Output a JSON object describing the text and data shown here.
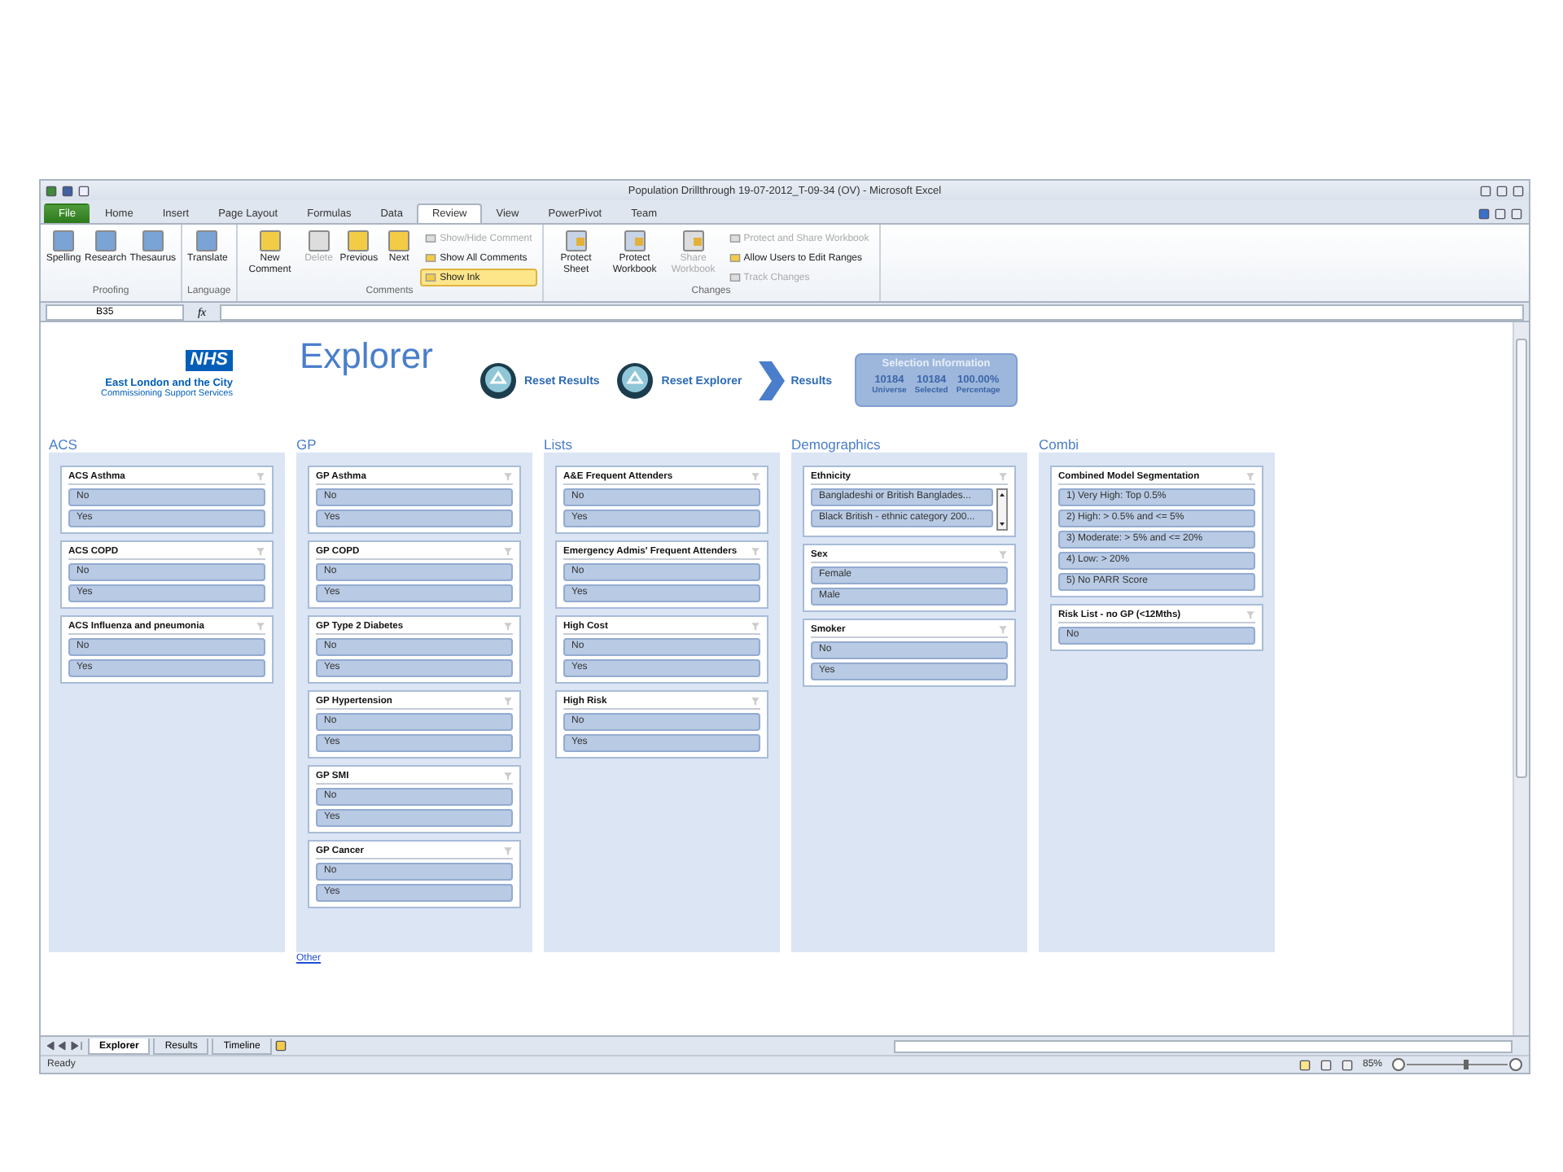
{
  "window": {
    "title": "Population Drillthrough 19-07-2012_T-09-34 (OV)  -  Microsoft Excel"
  },
  "ribbon_tabs": [
    {
      "label": "File",
      "kind": "file",
      "selected": false
    },
    {
      "label": "Home",
      "kind": "tab",
      "selected": false
    },
    {
      "label": "Insert",
      "kind": "tab",
      "selected": false
    },
    {
      "label": "Page Layout",
      "kind": "tab",
      "selected": false
    },
    {
      "label": "Formulas",
      "kind": "tab",
      "selected": false
    },
    {
      "label": "Data",
      "kind": "tab",
      "selected": false
    },
    {
      "label": "Review",
      "kind": "tab",
      "selected": true
    },
    {
      "label": "View",
      "kind": "tab",
      "selected": false
    },
    {
      "label": "PowerPivot",
      "kind": "tab",
      "selected": false
    },
    {
      "label": "Team",
      "kind": "tab",
      "selected": false
    }
  ],
  "ribbon_groups": [
    {
      "label": "Proofing",
      "buttons": [
        {
          "label": "Spelling",
          "disabled": false
        },
        {
          "label": "Research",
          "disabled": false
        },
        {
          "label": "Thesaurus",
          "disabled": false
        }
      ]
    },
    {
      "label": "Language",
      "buttons": [
        {
          "label": "Translate",
          "disabled": false
        }
      ]
    },
    {
      "label": "Comments",
      "buttons": [
        {
          "label": "New Comment",
          "disabled": false
        },
        {
          "label": "Delete",
          "disabled": true
        },
        {
          "label": "Previous",
          "disabled": false
        },
        {
          "label": "Next",
          "disabled": false
        }
      ],
      "small_buttons": [
        {
          "label": "Show/Hide Comment",
          "disabled": true,
          "on": false
        },
        {
          "label": "Show All Comments",
          "disabled": false,
          "on": false
        },
        {
          "label": "Show Ink",
          "disabled": false,
          "on": true
        }
      ]
    },
    {
      "label": "Changes",
      "buttons": [
        {
          "label": "Protect Sheet",
          "disabled": false
        },
        {
          "label": "Protect Workbook",
          "disabled": false
        },
        {
          "label": "Share Workbook",
          "disabled": true
        }
      ],
      "small_buttons": [
        {
          "label": "Protect and Share Workbook",
          "disabled": true,
          "on": false
        },
        {
          "label": "Allow Users to Edit Ranges",
          "disabled": false,
          "on": false
        },
        {
          "label": "Track Changes",
          "disabled": true,
          "on": false
        }
      ]
    }
  ],
  "formula_bar": {
    "name_box": "B35",
    "function_label": "fx"
  },
  "sheet": {
    "logo": {
      "mark": "NHS",
      "name": "East London and the City",
      "subtitle": "Commissioning Support Services"
    },
    "title": "Explorer",
    "actions": [
      {
        "label": "Reset Results",
        "kind": "reset"
      },
      {
        "label": "Reset Explorer",
        "kind": "reset"
      },
      {
        "label": "Results",
        "kind": "next"
      }
    ],
    "selection_info": {
      "title": "Selection Information",
      "stats": [
        {
          "value": "10184",
          "label": "Universe"
        },
        {
          "value": "10184",
          "label": "Selected"
        },
        {
          "value": "100.00%",
          "label": "Percentage"
        }
      ]
    },
    "columns": [
      {
        "heading": "ACS",
        "cards": [
          {
            "title": "ACS Asthma",
            "items": [
              "No",
              "Yes"
            ]
          },
          {
            "title": "ACS COPD",
            "items": [
              "No",
              "Yes"
            ]
          },
          {
            "title": "ACS Influenza and pneumonia",
            "items": [
              "No",
              "Yes"
            ]
          }
        ]
      },
      {
        "heading": "GP",
        "cards": [
          {
            "title": "GP Asthma",
            "items": [
              "No",
              "Yes"
            ]
          },
          {
            "title": "GP COPD",
            "items": [
              "No",
              "Yes"
            ]
          },
          {
            "title": "GP Type 2 Diabetes",
            "items": [
              "No",
              "Yes"
            ]
          },
          {
            "title": "GP Hypertension",
            "items": [
              "No",
              "Yes"
            ]
          },
          {
            "title": "GP SMI",
            "items": [
              "No",
              "Yes"
            ]
          },
          {
            "title": "GP Cancer",
            "items": [
              "No",
              "Yes"
            ]
          }
        ],
        "link": "Other"
      },
      {
        "heading": "Lists",
        "cards": [
          {
            "title": "A&E Frequent Attenders",
            "items": [
              "No",
              "Yes"
            ]
          },
          {
            "title": "Emergency Admis' Frequent Attenders",
            "items": [
              "No",
              "Yes"
            ]
          },
          {
            "title": "High Cost",
            "items": [
              "No",
              "Yes"
            ]
          },
          {
            "title": "High Risk",
            "items": [
              "No",
              "Yes"
            ]
          }
        ]
      },
      {
        "heading": "Demographics",
        "cards": [
          {
            "title": "Ethnicity",
            "items": [
              "Bangladeshi or British Banglades...",
              "Black British - ethnic category 200..."
            ],
            "scrollable": true
          },
          {
            "title": "Sex",
            "items": [
              "Female",
              "Male"
            ]
          },
          {
            "title": "Smoker",
            "items": [
              "No",
              "Yes"
            ]
          }
        ]
      },
      {
        "heading": "Combi",
        "cards": [
          {
            "title": "Combined Model Segmentation",
            "items": [
              "1) Very High: Top 0.5%",
              "2) High: > 0.5% and <= 5%",
              "3) Moderate: > 5% and <= 20%",
              "4) Low: > 20%",
              "5) No PARR Score"
            ]
          },
          {
            "title": "Risk List - no GP (<12Mths)",
            "items": [
              "No"
            ]
          }
        ]
      }
    ]
  },
  "sheet_tabs": [
    {
      "label": "Explorer",
      "selected": true
    },
    {
      "label": "Results",
      "selected": false
    },
    {
      "label": "Timeline",
      "selected": false
    }
  ],
  "status_bar": {
    "status": "Ready",
    "zoom": "85%"
  }
}
